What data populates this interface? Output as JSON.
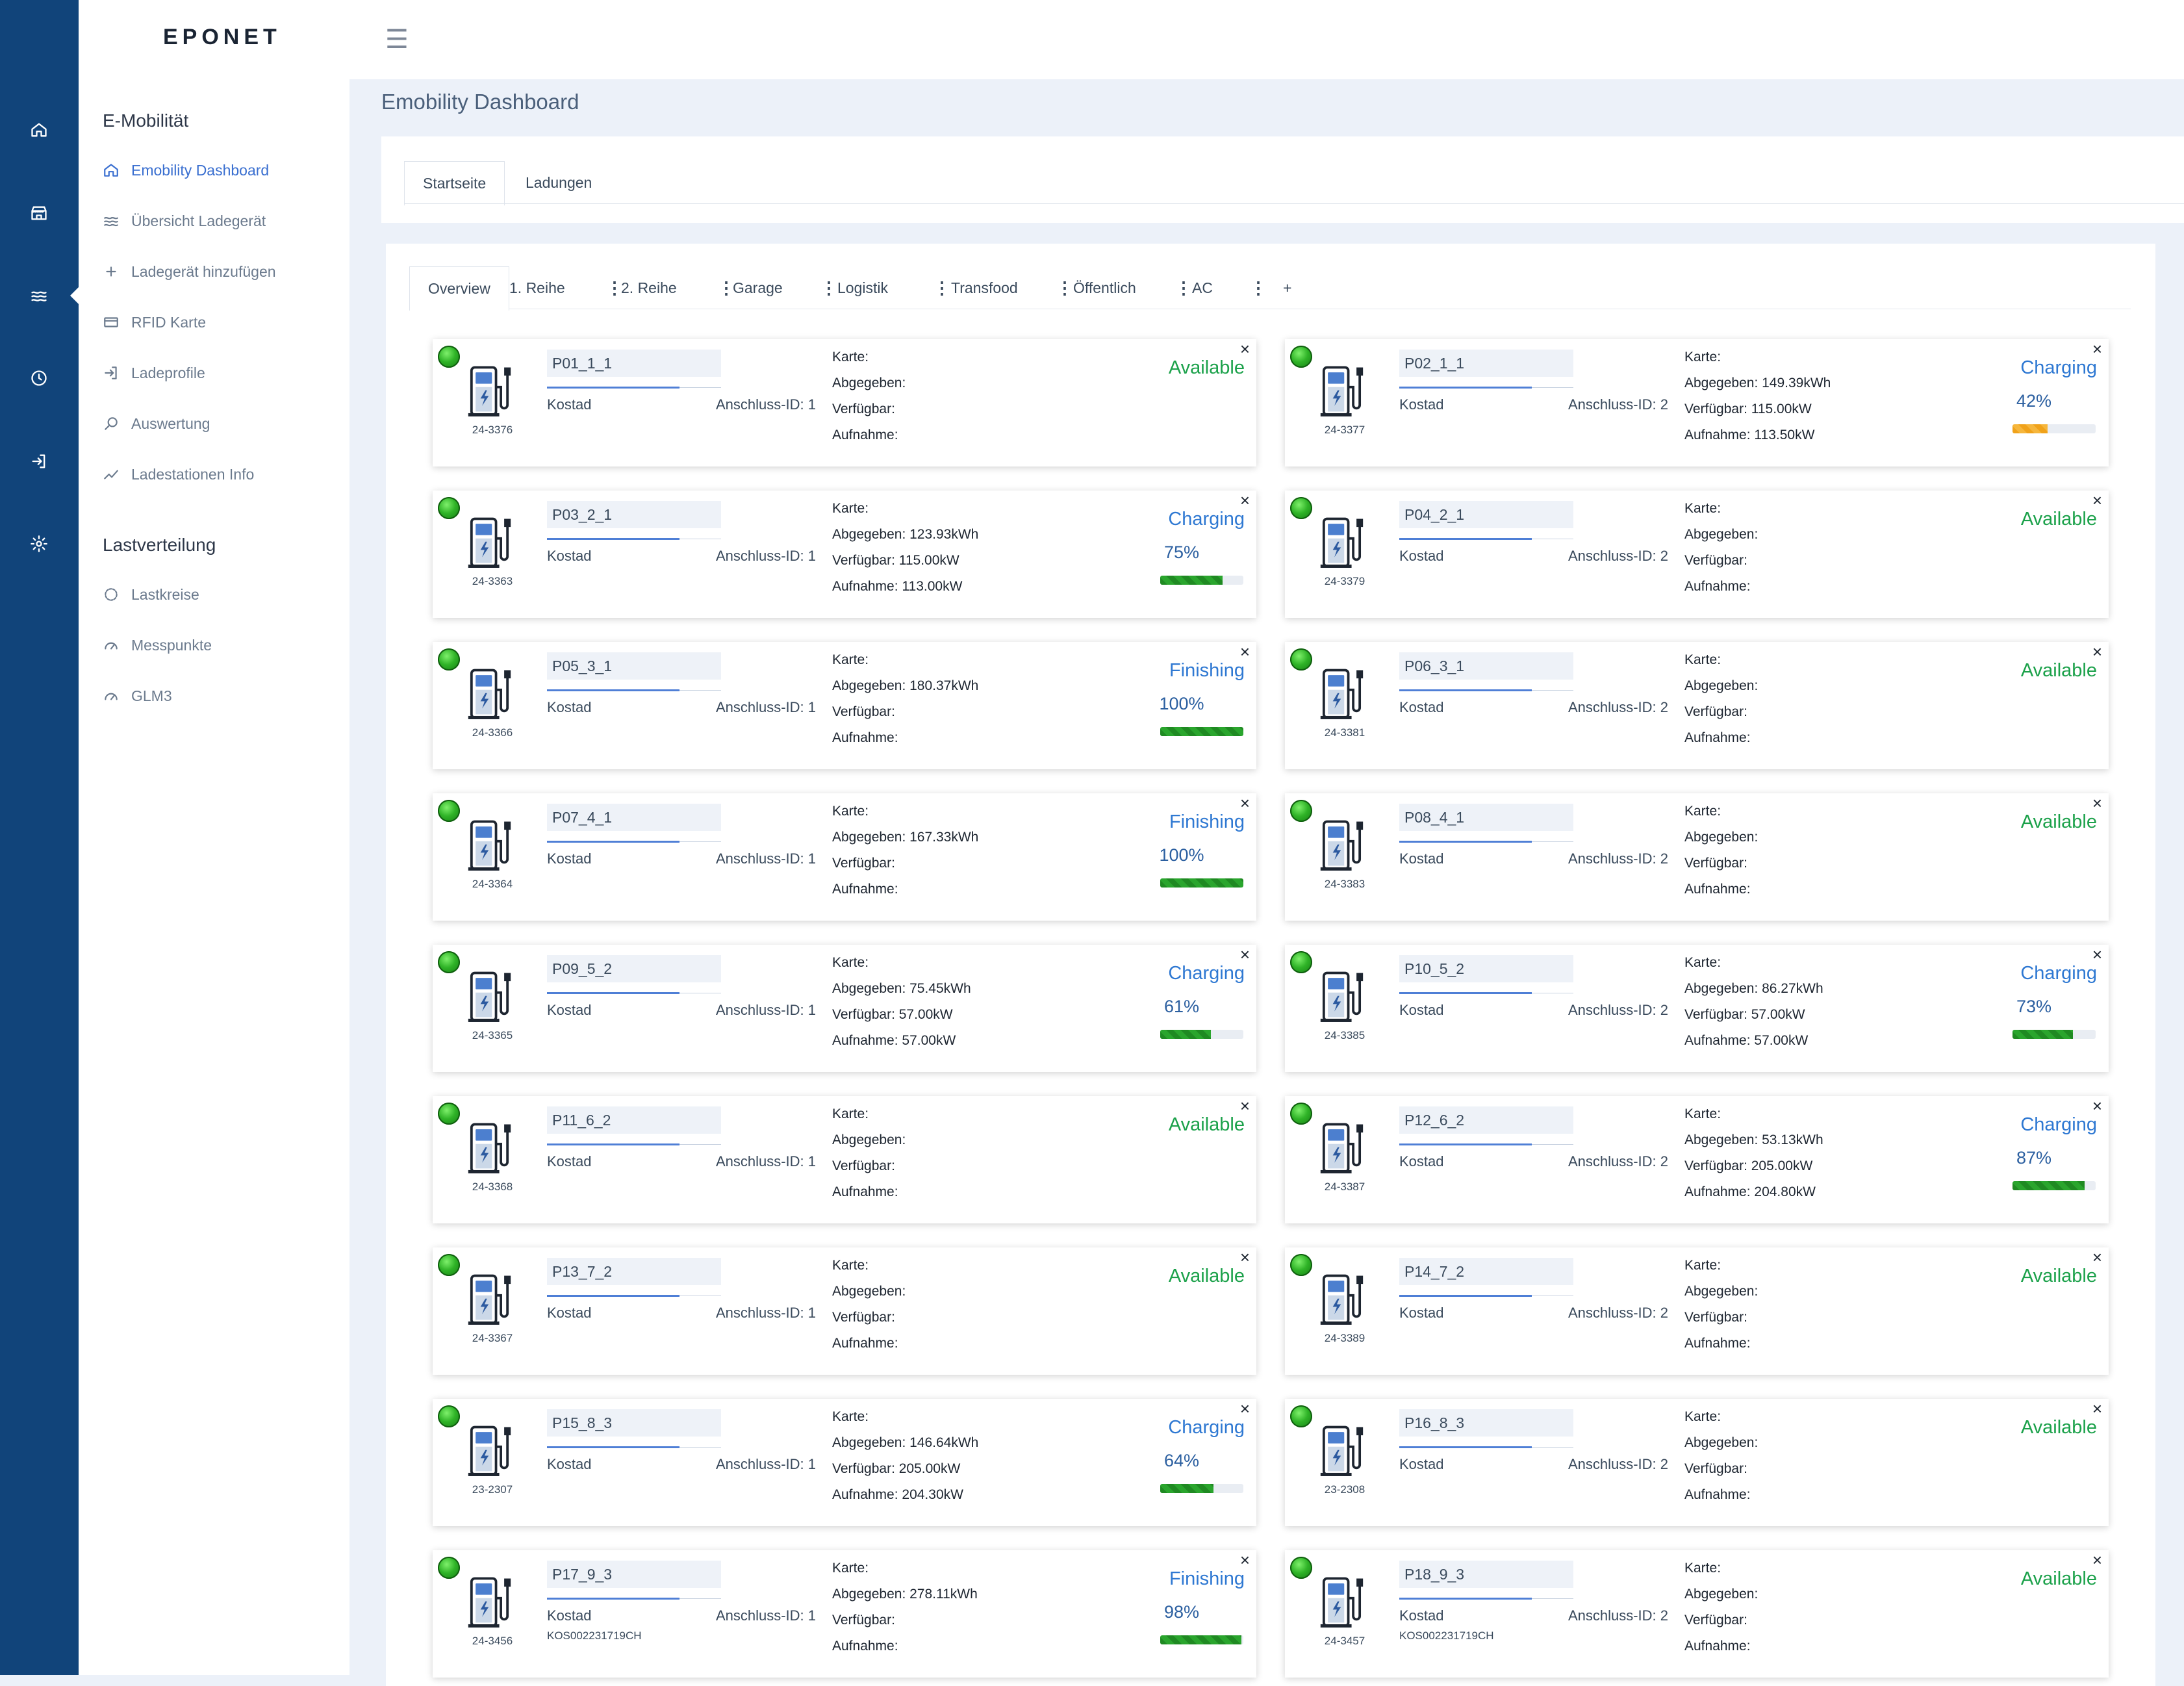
{
  "app": {
    "logo": "EPONET",
    "page_title": "Emobility Dashboard"
  },
  "colors": {
    "rail": "#11447a",
    "accent": "#3a6fd0",
    "available": "#1ba14a",
    "charging": "#2e78d2",
    "progress": "#1f8a22",
    "progress_low": "#f0a21a"
  },
  "rail_icons": [
    "home-icon",
    "store-icon",
    "waves-icon",
    "clock-icon",
    "login-icon",
    "gear-icon"
  ],
  "nav": {
    "group1": "E-Mobilität",
    "items1": [
      {
        "label": "Emobility Dashboard",
        "icon": "home-icon",
        "active": true
      },
      {
        "label": "Übersicht Ladegerät",
        "icon": "waves-icon"
      },
      {
        "label": "Ladegerät hinzufügen",
        "icon": "plus-icon"
      },
      {
        "label": "RFID Karte",
        "icon": "card-icon"
      },
      {
        "label": "Ladeprofile",
        "icon": "login-icon"
      },
      {
        "label": "Auswertung",
        "icon": "search-icon"
      },
      {
        "label": "Ladestationen Info",
        "icon": "trend-icon"
      }
    ],
    "group2": "Lastverteilung",
    "items2": [
      {
        "label": "Lastkreise",
        "icon": "circle-icon"
      },
      {
        "label": "Messpunkte",
        "icon": "gauge-icon"
      },
      {
        "label": "GLM3",
        "icon": "gauge-icon"
      }
    ]
  },
  "tabs": [
    "Startseite",
    "Ladungen"
  ],
  "subtabs": [
    "Overview",
    "1. Reihe",
    "2. Reihe",
    "Garage",
    "Logistik",
    "Transfood",
    "Öffentlich",
    "AC",
    "+"
  ],
  "labels": {
    "karte": "Karte:",
    "abgegeben": "Abgegeben:",
    "verfuegbar": "Verfügbar:",
    "aufnahme": "Aufnahme:",
    "kostad": "Kostad",
    "anschluss": "Anschluss-ID:"
  },
  "stations": [
    {
      "name": "P01_1_1",
      "number": "24-3376",
      "anschluss": "1",
      "status": "Available"
    },
    {
      "name": "P02_1_1",
      "number": "24-3377",
      "anschluss": "2",
      "status": "Charging",
      "percent": "42%",
      "progress": 0.42,
      "abgegeben": "149.39kWh",
      "verfuegbar": "115.00kW",
      "aufnahme": "113.50kW"
    },
    {
      "name": "P03_2_1",
      "number": "24-3363",
      "anschluss": "1",
      "status": "Charging",
      "percent": "75%",
      "progress": 0.75,
      "abgegeben": "123.93kWh",
      "verfuegbar": "115.00kW",
      "aufnahme": "113.00kW"
    },
    {
      "name": "P04_2_1",
      "number": "24-3379",
      "anschluss": "2",
      "status": "Available"
    },
    {
      "name": "P05_3_1",
      "number": "24-3366",
      "anschluss": "1",
      "status": "Finishing",
      "percent": "100%",
      "progress": 1.0,
      "abgegeben": "180.37kWh"
    },
    {
      "name": "P06_3_1",
      "number": "24-3381",
      "anschluss": "2",
      "status": "Available"
    },
    {
      "name": "P07_4_1",
      "number": "24-3364",
      "anschluss": "1",
      "status": "Finishing",
      "percent": "100%",
      "progress": 1.0,
      "abgegeben": "167.33kWh"
    },
    {
      "name": "P08_4_1",
      "number": "24-3383",
      "anschluss": "2",
      "status": "Available"
    },
    {
      "name": "P09_5_2",
      "number": "24-3365",
      "anschluss": "1",
      "status": "Charging",
      "percent": "61%",
      "progress": 0.61,
      "abgegeben": "75.45kWh",
      "verfuegbar": "57.00kW",
      "aufnahme": "57.00kW"
    },
    {
      "name": "P10_5_2",
      "number": "24-3385",
      "anschluss": "2",
      "status": "Charging",
      "percent": "73%",
      "progress": 0.73,
      "abgegeben": "86.27kWh",
      "verfuegbar": "57.00kW",
      "aufnahme": "57.00kW"
    },
    {
      "name": "P11_6_2",
      "number": "24-3368",
      "anschluss": "1",
      "status": "Available"
    },
    {
      "name": "P12_6_2",
      "number": "24-3387",
      "anschluss": "2",
      "status": "Charging",
      "percent": "87%",
      "progress": 0.87,
      "abgegeben": "53.13kWh",
      "verfuegbar": "205.00kW",
      "aufnahme": "204.80kW"
    },
    {
      "name": "P13_7_2",
      "number": "24-3367",
      "anschluss": "1",
      "status": "Available"
    },
    {
      "name": "P14_7_2",
      "number": "24-3389",
      "anschluss": "2",
      "status": "Available"
    },
    {
      "name": "P15_8_3",
      "number": "23-2307",
      "anschluss": "1",
      "status": "Charging",
      "percent": "64%",
      "progress": 0.64,
      "abgegeben": "146.64kWh",
      "verfuegbar": "205.00kW",
      "aufnahme": "204.30kW"
    },
    {
      "name": "P16_8_3",
      "number": "23-2308",
      "anschluss": "2",
      "status": "Available"
    },
    {
      "name": "P17_9_3",
      "number": "24-3456",
      "anschluss": "1",
      "status": "Finishing",
      "percent": "98%",
      "progress": 0.98,
      "abgegeben": "278.11kWh",
      "kos": "KOS002231719CH"
    },
    {
      "name": "P18_9_3",
      "number": "24-3457",
      "anschluss": "2",
      "status": "Available",
      "kos": "KOS002231719CH"
    }
  ]
}
